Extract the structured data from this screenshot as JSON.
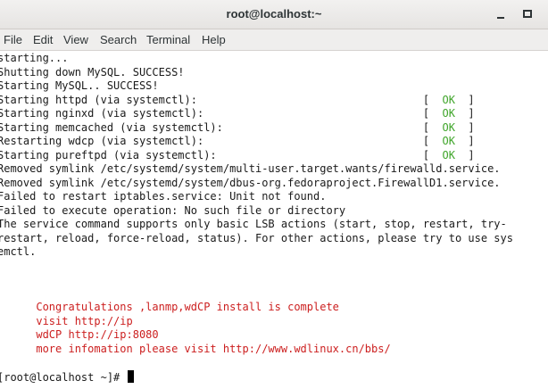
{
  "window": {
    "title": "root@localhost:~"
  },
  "menu": [
    "File",
    "Edit",
    "View",
    "Search",
    "Terminal",
    "Help"
  ],
  "terminal": {
    "lines": [
      {
        "text": "starting...",
        "color": "default"
      },
      {
        "text": "Shutting down MySQL. SUCCESS!",
        "color": "default"
      },
      {
        "text": "Starting MySQL.. SUCCESS!",
        "color": "default"
      },
      {
        "text": "Starting httpd (via systemctl):",
        "status": "OK"
      },
      {
        "text": "Starting nginxd (via systemctl):",
        "status": "OK"
      },
      {
        "text": "Starting memcached (via systemctl):",
        "status": "OK"
      },
      {
        "text": "Restarting wdcp (via systemctl):",
        "status": "OK"
      },
      {
        "text": "Starting pureftpd (via systemctl):",
        "status": "OK"
      },
      {
        "text": "Removed symlink /etc/systemd/system/multi-user.target.wants/firewalld.service.",
        "color": "default"
      },
      {
        "text": "Removed symlink /etc/systemd/system/dbus-org.fedoraproject.FirewallD1.service.",
        "color": "default"
      },
      {
        "text": "Failed to restart iptables.service: Unit not found.",
        "color": "default"
      },
      {
        "text": "Failed to execute operation: No such file or directory",
        "color": "default"
      },
      {
        "text": "The service command supports only basic LSB actions (start, stop, restart, try-",
        "color": "default"
      },
      {
        "text": "restart, reload, force-reload, status). For other actions, please try to use sys",
        "color": "default"
      },
      {
        "text": "emctl.",
        "color": "default"
      },
      {
        "text": "",
        "color": "default"
      },
      {
        "text": "",
        "color": "default"
      },
      {
        "text": "",
        "color": "default"
      },
      {
        "text": "      Congratulations ,lanmp,wdCP install is complete",
        "color": "red"
      },
      {
        "text": "      visit http://ip",
        "color": "red"
      },
      {
        "text": "      wdCP http://ip:8080",
        "color": "red"
      },
      {
        "text": "      more infomation please visit http://www.wdlinux.cn/bbs/",
        "color": "red"
      },
      {
        "text": "",
        "color": "default"
      },
      {
        "text": "[root@localhost ~]# ",
        "color": "default",
        "cursor": true
      }
    ]
  },
  "colors": {
    "ok": "#3fa52a",
    "message": "#cc1f1f",
    "text": "#1a1a1a"
  }
}
